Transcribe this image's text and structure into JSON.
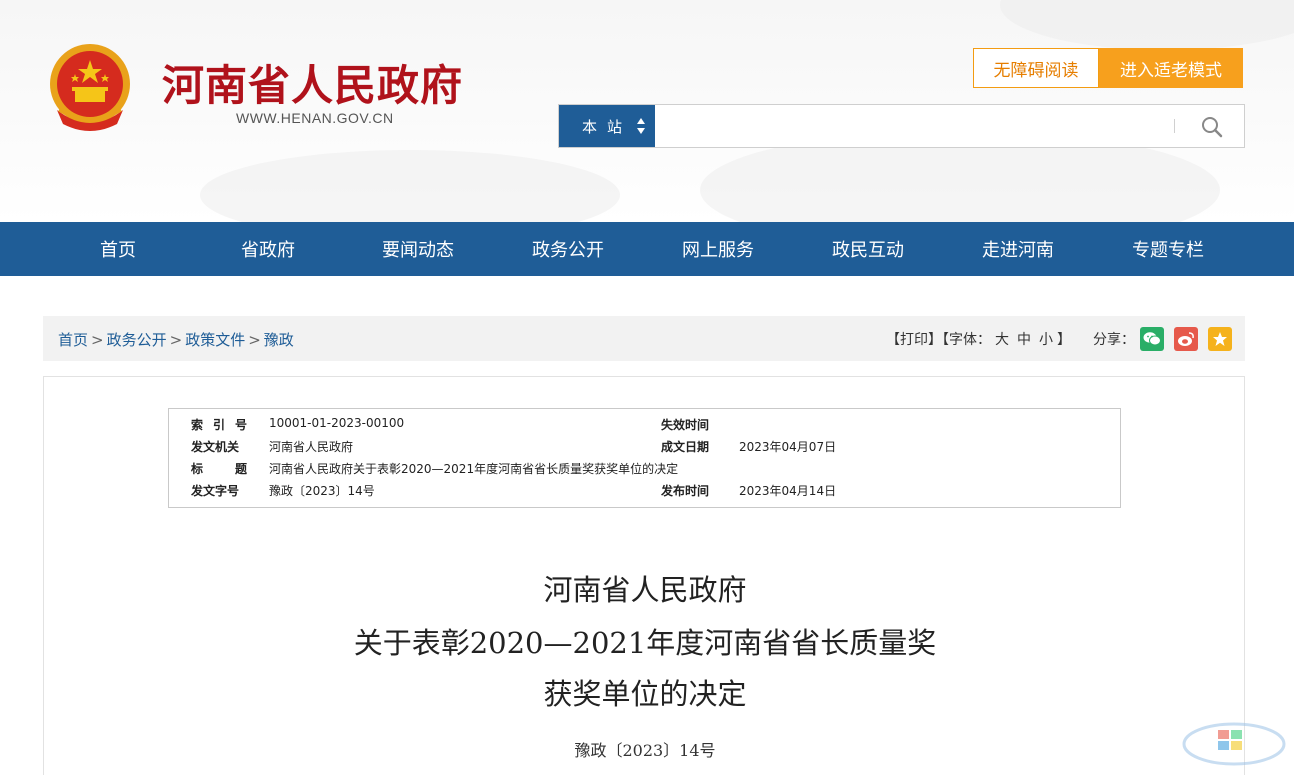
{
  "header": {
    "site_title": "河南省人民政府",
    "site_url": "WWW.HENAN.GOV.CN",
    "accessibility_label": "无障碍阅读",
    "elder_mode_label": "进入适老模式",
    "search": {
      "scope_label": "本站",
      "placeholder": ""
    }
  },
  "nav": {
    "items": [
      {
        "label": "首页"
      },
      {
        "label": "省政府"
      },
      {
        "label": "要闻动态"
      },
      {
        "label": "政务公开"
      },
      {
        "label": "网上服务"
      },
      {
        "label": "政民互动"
      },
      {
        "label": "走进河南"
      },
      {
        "label": "专题专栏"
      }
    ]
  },
  "breadcrumb": {
    "items": [
      {
        "label": "首页"
      },
      {
        "label": "政务公开"
      },
      {
        "label": "政策文件"
      },
      {
        "label": "豫政"
      }
    ],
    "separator": ">"
  },
  "tools": {
    "print": "【打印】",
    "font_prefix": "【字体：",
    "font_large": "大",
    "font_medium": "中",
    "font_small": "小",
    "font_suffix": "】",
    "share_label": "分享："
  },
  "meta": {
    "index_label": "索引号",
    "index_value": "10001-01-2023-00100",
    "expire_label": "失效时间",
    "expire_value": "",
    "issuer_label": "发文机关",
    "issuer_value": "河南省人民政府",
    "created_label": "成文日期",
    "created_value": "2023年04月07日",
    "title_label": "标题",
    "title_value": "河南省人民政府关于表彰2020—2021年度河南省省长质量奖获奖单位的决定",
    "docno_label": "发文字号",
    "docno_value": "豫政〔2023〕14号",
    "published_label": "发布时间",
    "published_value": "2023年04月14日"
  },
  "article": {
    "title_line1": "河南省人民政府",
    "title_line2": "关于表彰2020—2021年度河南省省长质量奖",
    "title_line3": "获奖单位的决定",
    "doc_number": "豫政〔2023〕14号"
  },
  "colors": {
    "brand_red": "#b0121b",
    "nav_blue": "#1f5d97",
    "accent_orange": "#f7a01d",
    "wechat_green": "#2aae67",
    "weibo_red": "#e6594b",
    "favorite_yellow": "#f5b21c"
  },
  "icons": {
    "emblem": "national-emblem-icon",
    "scope_toggle": "sort-arrows-icon",
    "search": "search-icon",
    "wechat": "wechat-icon",
    "weibo": "weibo-icon",
    "favorite": "star-icon"
  }
}
